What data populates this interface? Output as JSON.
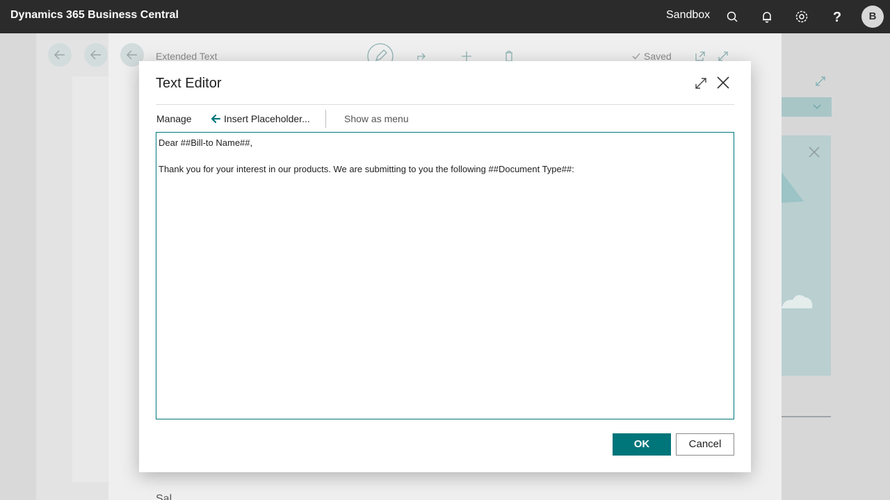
{
  "app": {
    "title": "Dynamics 365 Business Central",
    "environment": "Sandbox",
    "avatar_initial": "B",
    "icons": [
      "search-icon",
      "bell-icon",
      "gear-icon",
      "help-icon"
    ]
  },
  "background_page": {
    "title": "Extended Text",
    "saved_label": "Saved",
    "section_partial": "Sal"
  },
  "dialog": {
    "title": "Text Editor",
    "toolbar": {
      "manage": "Manage",
      "insert_placeholder": "Insert Placeholder...",
      "show_as_menu": "Show as menu"
    },
    "editor_text": "Dear ##Bill-to Name##,\n\nThank you for your interest in our products. We are submitting to you the following ##Document Type##:",
    "ok_label": "OK",
    "cancel_label": "Cancel"
  },
  "colors": {
    "appbar": "#2b2b2b",
    "accent": "#00757a"
  }
}
